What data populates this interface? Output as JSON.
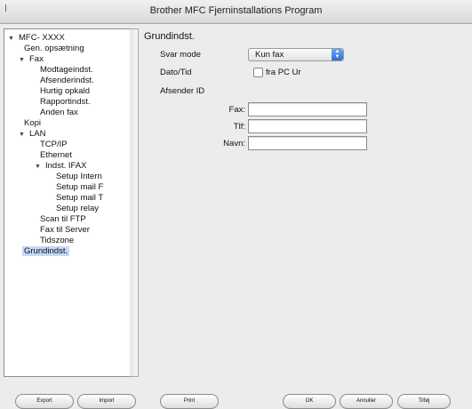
{
  "window": {
    "title": "Brother MFC Fjerninstallations Program"
  },
  "tree": {
    "root": "MFC- XXXX",
    "gen": "Gen. opsætning",
    "fax": "Fax",
    "modtage": "Modtageindst.",
    "afsender": "Afsenderindst.",
    "hurtig": "Hurtig opkald",
    "rapport": "Rapportindst.",
    "andenfax": "Anden fax",
    "kopi": "Kopi",
    "lan": "LAN",
    "tcpip": "TCP/IP",
    "ethernet": "Ethernet",
    "ifax": "Indst. IFAX",
    "setup_internet": "Setup Intern",
    "setup_mail_rx": "Setup mail F",
    "setup_mail_tx": "Setup mail T",
    "setup_relay": "Setup relay",
    "scan_ftp": "Scan til FTP",
    "fax_server": "Fax til Server",
    "tidszone": "Tidszone",
    "grundindst": "Grundindst."
  },
  "main": {
    "section_title": "Grundindst.",
    "svar_mode_label": "Svar mode",
    "svar_mode_value": "Kun fax",
    "dato_tid_label": "Dato/Tid",
    "fra_pc_ur_label": "fra PC Ur",
    "afsender_id_label": "Afsender ID",
    "fax_label": "Fax:",
    "fax_value": "",
    "tlf_label": "Tlf:",
    "tlf_value": "",
    "navn_label": "Navn:",
    "navn_value": ""
  },
  "buttons": {
    "export": "Export",
    "import": "Import",
    "print": "Print",
    "ok": "OK",
    "annuller": "Annuller",
    "tilfoj": "Tilføj"
  },
  "colors": {
    "selection": "#c3d9f6",
    "popup_accent": "#2d6fd4"
  }
}
